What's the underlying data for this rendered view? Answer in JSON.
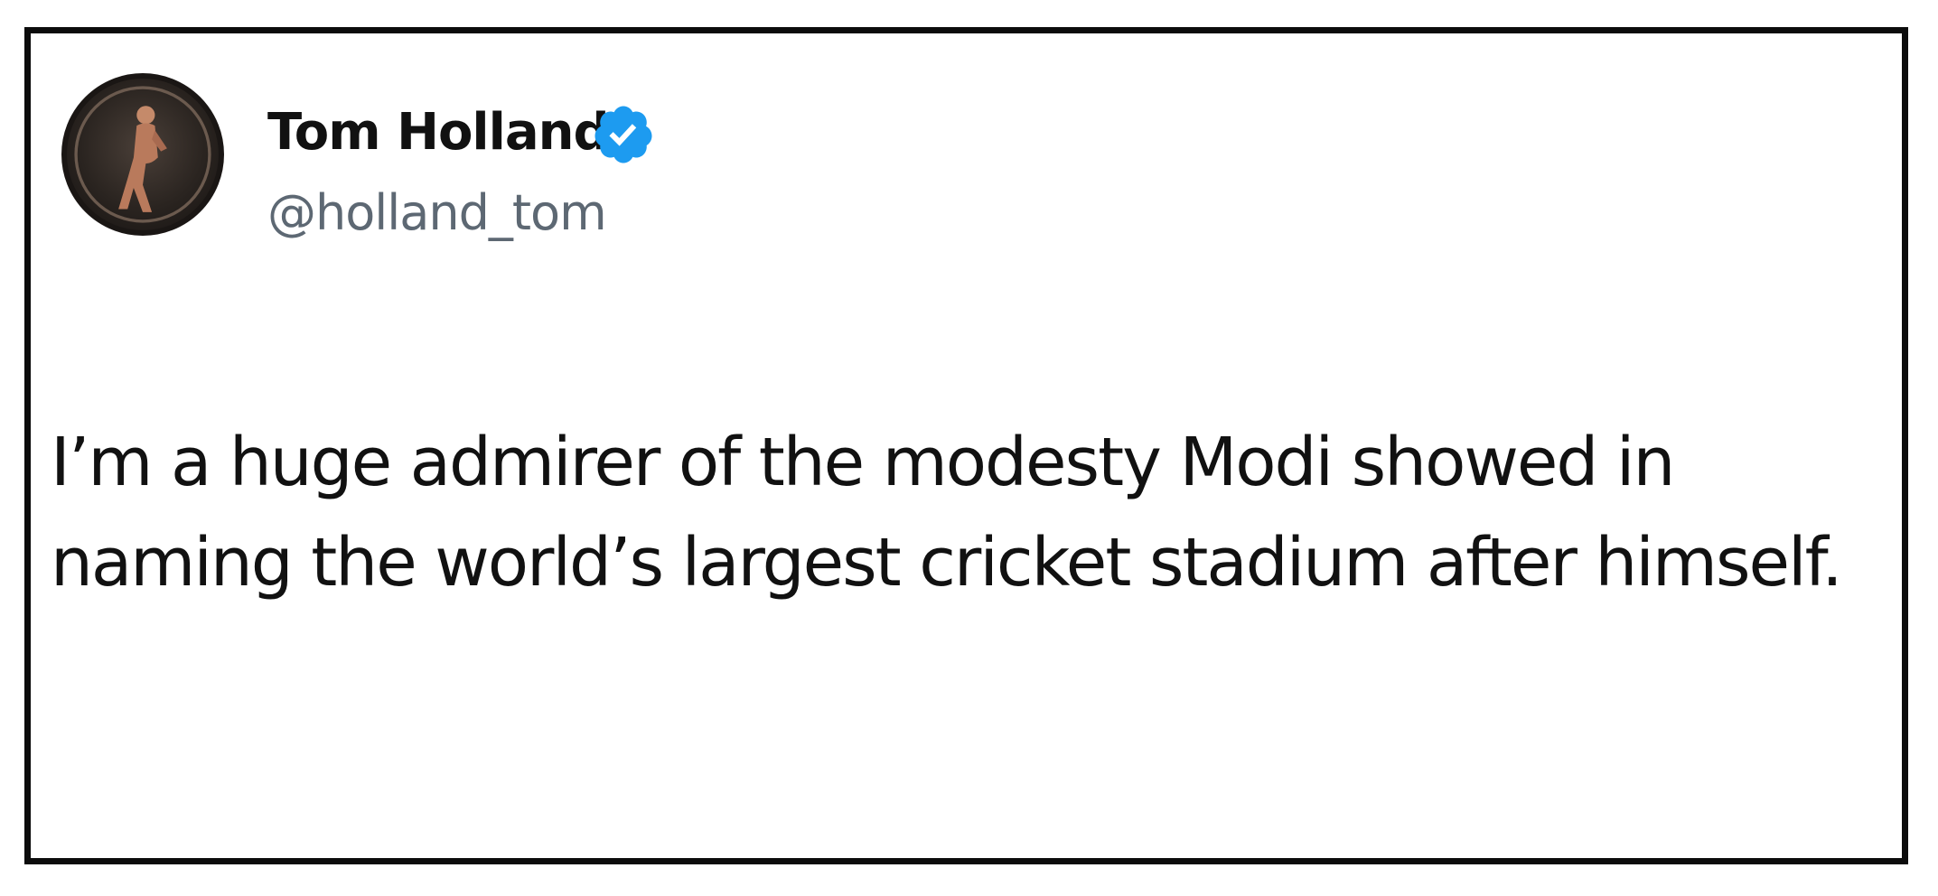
{
  "tweet": {
    "author": {
      "name": "Tom Holland",
      "handle": "@holland_tom",
      "verified": true,
      "avatar_icon": "avatar-image"
    },
    "text": "I’m a huge admirer of the modesty Modi showed in naming the world’s largest cricket stadium after himself."
  },
  "colors": {
    "verified_badge": "#1d9bf0",
    "text": "#111111",
    "handle": "#5d6873",
    "frame_border": "#0c0c0c"
  }
}
